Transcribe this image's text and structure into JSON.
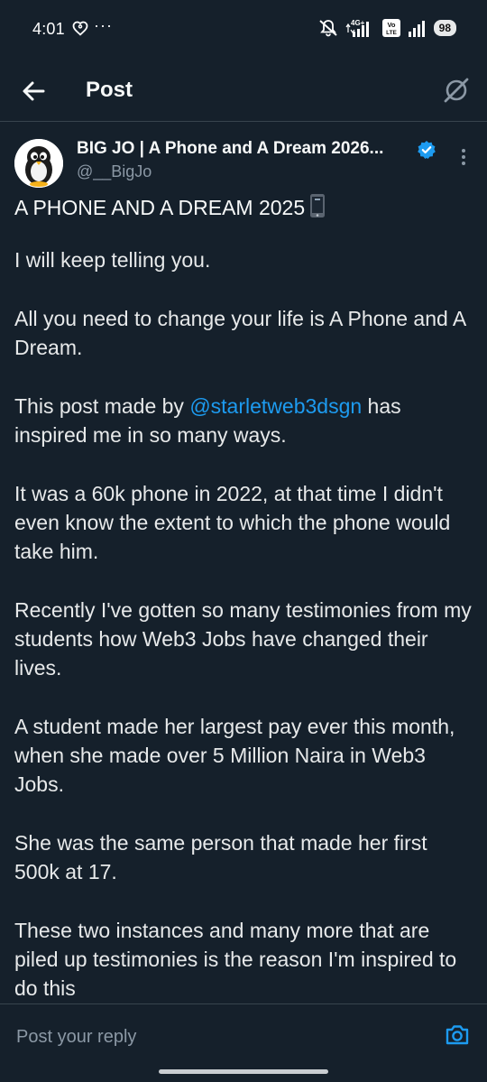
{
  "status_bar": {
    "time": "4:01",
    "dots": "···",
    "network_label": "4G+",
    "volte_label": "Vo LTE",
    "battery": "98"
  },
  "top_bar": {
    "title": "Post"
  },
  "post": {
    "author_name": "BIG JO | A Phone and A Dream 2026...",
    "author_handle": "@__BigJo",
    "title": "A PHONE AND A DREAM 2025",
    "paragraphs": [
      {
        "text": "I will keep telling you."
      },
      {
        "text": "All you need to change your life is A Phone and A Dream."
      },
      {
        "before": "This post made by ",
        "mention": "@starletweb3dsgn",
        "after": " has inspired me in so many ways."
      },
      {
        "text": "It was a 60k phone in 2022, at that time I didn't even know the extent to which the phone would take him."
      },
      {
        "text": "Recently I've gotten so many testimonies from my students how Web3 Jobs have changed their lives."
      },
      {
        "text": "A student made her largest pay ever this month, when she made over 5 Million Naira in Web3 Jobs."
      },
      {
        "text": "She was the same person that made her first 500k at 17."
      },
      {
        "text": "These two instances and many more that are piled up testimonies is the reason I'm inspired to do this"
      }
    ]
  },
  "reply": {
    "placeholder": "Post your reply"
  },
  "colors": {
    "background": "#15202b",
    "accent": "#1d9bf0",
    "text": "#e7e9ea",
    "muted": "#8b98a5",
    "divider": "#38444d"
  },
  "icons": {
    "back": "arrow-left-icon",
    "grok": "grok-icon",
    "verified": "verified-badge-icon",
    "more": "more-vertical-icon",
    "phone": "mobile-phone-icon",
    "camera": "camera-icon"
  }
}
